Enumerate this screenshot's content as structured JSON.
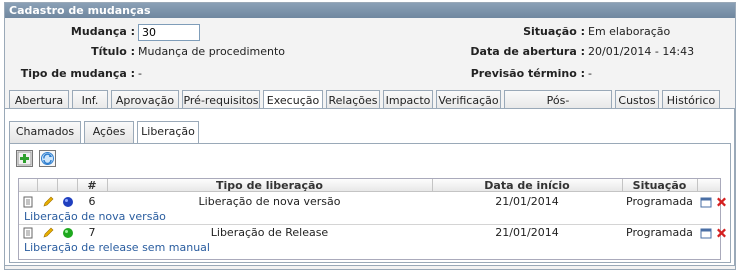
{
  "panel": {
    "title": "Cadastro de mudanças"
  },
  "fields": {
    "mudanca_label": "Mudança :",
    "mudanca_value": "30",
    "titulo_label": "Título :",
    "titulo_value": "Mudança de procedimento",
    "tipo_label": "Tipo de mudança :",
    "tipo_value": "-",
    "situacao_label": "Situação :",
    "situacao_value": "Em elaboração",
    "data_abertura_label": "Data de abertura :",
    "data_abertura_value": "20/01/2014 - 14:43",
    "previsao_label": "Previsão término :",
    "previsao_value": "-"
  },
  "main_tabs": [
    "Abertura",
    "Inf.",
    "Aprovação",
    "Pré-requisitos",
    "Execução",
    "Relações",
    "Impacto",
    "Verificação",
    "Pós-implementação",
    "Custos",
    "Histórico"
  ],
  "active_main_tab": "Execução",
  "sub_tabs": [
    "Chamados",
    "Ações",
    "Liberação"
  ],
  "active_sub_tab": "Liberação",
  "toolbar": {
    "add_icon": "add-icon",
    "refresh_icon": "refresh-icon"
  },
  "table": {
    "headers": {
      "num": "#",
      "tipo": "Tipo de liberação",
      "data": "Data de início",
      "situacao": "Situação"
    },
    "rows": [
      {
        "num": "6",
        "tipo": "Liberação de nova versão",
        "data": "21/01/2014",
        "situacao": "Programada",
        "link": "Liberação de nova versão",
        "status_color": "#1f3fbf"
      },
      {
        "num": "7",
        "tipo": "Liberação de Release",
        "data": "21/01/2014",
        "situacao": "Programada",
        "link": "Liberação de release sem manual",
        "status_color": "#1ea81e"
      }
    ]
  },
  "colors": {
    "header_bar": "#7690a8",
    "link": "#2a5d9f",
    "delete": "#d42020"
  }
}
